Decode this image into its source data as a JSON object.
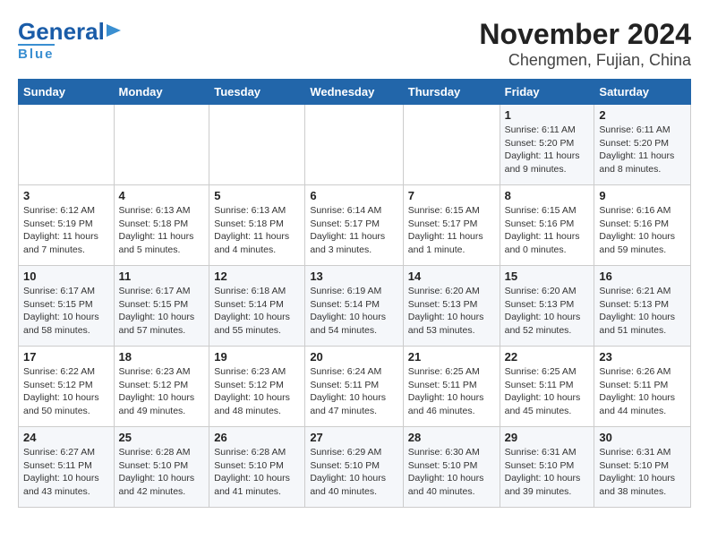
{
  "header": {
    "logo_line1": "General",
    "logo_line2": "Blue",
    "title": "November 2024",
    "subtitle": "Chengmen, Fujian, China"
  },
  "calendar": {
    "weekdays": [
      "Sunday",
      "Monday",
      "Tuesday",
      "Wednesday",
      "Thursday",
      "Friday",
      "Saturday"
    ],
    "weeks": [
      [
        {
          "day": "",
          "info": ""
        },
        {
          "day": "",
          "info": ""
        },
        {
          "day": "",
          "info": ""
        },
        {
          "day": "",
          "info": ""
        },
        {
          "day": "",
          "info": ""
        },
        {
          "day": "1",
          "info": "Sunrise: 6:11 AM\nSunset: 5:20 PM\nDaylight: 11 hours and 9 minutes."
        },
        {
          "day": "2",
          "info": "Sunrise: 6:11 AM\nSunset: 5:20 PM\nDaylight: 11 hours and 8 minutes."
        }
      ],
      [
        {
          "day": "3",
          "info": "Sunrise: 6:12 AM\nSunset: 5:19 PM\nDaylight: 11 hours and 7 minutes."
        },
        {
          "day": "4",
          "info": "Sunrise: 6:13 AM\nSunset: 5:18 PM\nDaylight: 11 hours and 5 minutes."
        },
        {
          "day": "5",
          "info": "Sunrise: 6:13 AM\nSunset: 5:18 PM\nDaylight: 11 hours and 4 minutes."
        },
        {
          "day": "6",
          "info": "Sunrise: 6:14 AM\nSunset: 5:17 PM\nDaylight: 11 hours and 3 minutes."
        },
        {
          "day": "7",
          "info": "Sunrise: 6:15 AM\nSunset: 5:17 PM\nDaylight: 11 hours and 1 minute."
        },
        {
          "day": "8",
          "info": "Sunrise: 6:15 AM\nSunset: 5:16 PM\nDaylight: 11 hours and 0 minutes."
        },
        {
          "day": "9",
          "info": "Sunrise: 6:16 AM\nSunset: 5:16 PM\nDaylight: 10 hours and 59 minutes."
        }
      ],
      [
        {
          "day": "10",
          "info": "Sunrise: 6:17 AM\nSunset: 5:15 PM\nDaylight: 10 hours and 58 minutes."
        },
        {
          "day": "11",
          "info": "Sunrise: 6:17 AM\nSunset: 5:15 PM\nDaylight: 10 hours and 57 minutes."
        },
        {
          "day": "12",
          "info": "Sunrise: 6:18 AM\nSunset: 5:14 PM\nDaylight: 10 hours and 55 minutes."
        },
        {
          "day": "13",
          "info": "Sunrise: 6:19 AM\nSunset: 5:14 PM\nDaylight: 10 hours and 54 minutes."
        },
        {
          "day": "14",
          "info": "Sunrise: 6:20 AM\nSunset: 5:13 PM\nDaylight: 10 hours and 53 minutes."
        },
        {
          "day": "15",
          "info": "Sunrise: 6:20 AM\nSunset: 5:13 PM\nDaylight: 10 hours and 52 minutes."
        },
        {
          "day": "16",
          "info": "Sunrise: 6:21 AM\nSunset: 5:13 PM\nDaylight: 10 hours and 51 minutes."
        }
      ],
      [
        {
          "day": "17",
          "info": "Sunrise: 6:22 AM\nSunset: 5:12 PM\nDaylight: 10 hours and 50 minutes."
        },
        {
          "day": "18",
          "info": "Sunrise: 6:23 AM\nSunset: 5:12 PM\nDaylight: 10 hours and 49 minutes."
        },
        {
          "day": "19",
          "info": "Sunrise: 6:23 AM\nSunset: 5:12 PM\nDaylight: 10 hours and 48 minutes."
        },
        {
          "day": "20",
          "info": "Sunrise: 6:24 AM\nSunset: 5:11 PM\nDaylight: 10 hours and 47 minutes."
        },
        {
          "day": "21",
          "info": "Sunrise: 6:25 AM\nSunset: 5:11 PM\nDaylight: 10 hours and 46 minutes."
        },
        {
          "day": "22",
          "info": "Sunrise: 6:25 AM\nSunset: 5:11 PM\nDaylight: 10 hours and 45 minutes."
        },
        {
          "day": "23",
          "info": "Sunrise: 6:26 AM\nSunset: 5:11 PM\nDaylight: 10 hours and 44 minutes."
        }
      ],
      [
        {
          "day": "24",
          "info": "Sunrise: 6:27 AM\nSunset: 5:11 PM\nDaylight: 10 hours and 43 minutes."
        },
        {
          "day": "25",
          "info": "Sunrise: 6:28 AM\nSunset: 5:10 PM\nDaylight: 10 hours and 42 minutes."
        },
        {
          "day": "26",
          "info": "Sunrise: 6:28 AM\nSunset: 5:10 PM\nDaylight: 10 hours and 41 minutes."
        },
        {
          "day": "27",
          "info": "Sunrise: 6:29 AM\nSunset: 5:10 PM\nDaylight: 10 hours and 40 minutes."
        },
        {
          "day": "28",
          "info": "Sunrise: 6:30 AM\nSunset: 5:10 PM\nDaylight: 10 hours and 40 minutes."
        },
        {
          "day": "29",
          "info": "Sunrise: 6:31 AM\nSunset: 5:10 PM\nDaylight: 10 hours and 39 minutes."
        },
        {
          "day": "30",
          "info": "Sunrise: 6:31 AM\nSunset: 5:10 PM\nDaylight: 10 hours and 38 minutes."
        }
      ]
    ]
  }
}
